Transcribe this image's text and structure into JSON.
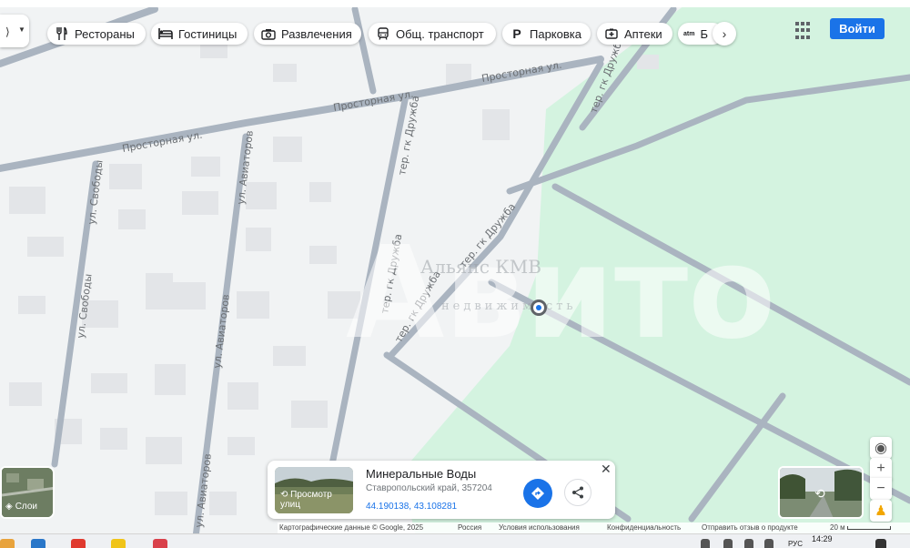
{
  "map": {
    "streets": {
      "prostornaya": "Просторная ул.",
      "svobody": "ул. Свободы",
      "aviatorov": "ул. Авиаторов",
      "ter_druzhba": "тер. гк Дружба",
      "ter_druzhba_top": "тер. гк Дружба"
    },
    "watermark": "Авито",
    "watermark_sub": "Альянс КМВ",
    "watermark_sub2": "недвижимость",
    "colors": {
      "park": "#d4f3e0",
      "land": "#f1f3f4",
      "road": "#aab4c0",
      "building": "#e3e5e8"
    }
  },
  "categories": [
    {
      "icon": "restaurant-icon",
      "label": "Рестораны"
    },
    {
      "icon": "hotel-icon",
      "label": "Гостиницы"
    },
    {
      "icon": "camera-icon",
      "label": "Развлечения"
    },
    {
      "icon": "transit-icon",
      "label": "Общ. транспорт"
    },
    {
      "icon": "parking-icon",
      "label": "Парковка"
    },
    {
      "icon": "pharmacy-icon",
      "label": "Аптеки"
    },
    {
      "icon": "atm-icon",
      "label": "Б"
    }
  ],
  "header": {
    "sign_in": "Войти"
  },
  "layers": {
    "label": "Слои"
  },
  "place_card": {
    "streetview_label": "Просмотр улиц",
    "title": "Минеральные Воды",
    "address": "Ставропольский край, 357204",
    "coords": "44.190138, 43.108281"
  },
  "footer": {
    "map_data": "Картографические данные © Google, 2025",
    "country": "Россия",
    "terms": "Условия использования",
    "privacy": "Конфиденциальность",
    "feedback": "Отправить отзыв о продукте",
    "scale": "20 м"
  },
  "taskbar": {
    "lang": "РУС",
    "time": "14:29"
  }
}
